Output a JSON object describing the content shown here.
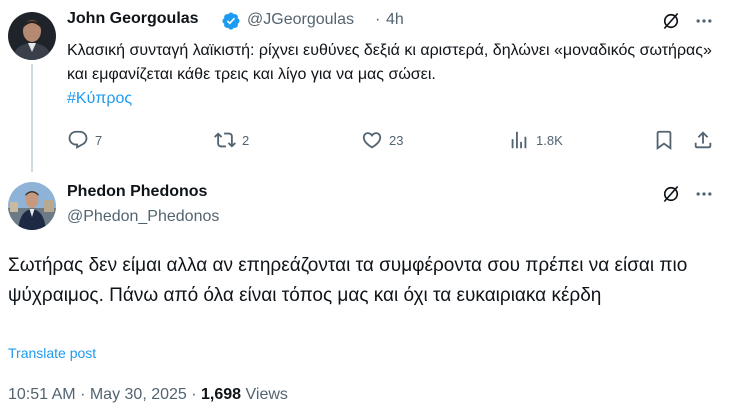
{
  "tweet1": {
    "name": "John Georgoulas",
    "handle": "@JGeorgoulas",
    "sep": "·",
    "time": "4h",
    "text": "Κλασική συνταγή λαϊκιστή: ρίχνει ευθύνες δεξιά κι αριστερά, δηλώνει «μοναδικός σωτήρας» και εμφανίζεται κάθε τρεις και λίγο για να μας σώσει.",
    "hashtag": "#Κύπρος",
    "actions": {
      "replies": "7",
      "reposts": "2",
      "likes": "23",
      "views": "1.8K"
    }
  },
  "tweet2": {
    "name": "Phedon Phedonos",
    "handle": "@Phedon_Phedonos",
    "text": "Σωτήρας δεν είμαι αλλα αν επηρεάζονται τα συμφέροντα σου πρέπει να είσαι πιο ψύχραιμος.  Πάνω από όλα είναι τόπος μας και όχι τα ευκαιριακα κέρδη",
    "translate": "Translate post",
    "time": "10:51 AM",
    "dot1": "·",
    "date": "May 30, 2025",
    "dot2": "·",
    "views_count": "1,698",
    "views_label": "Views"
  },
  "colors": {
    "accent": "#1d9bf0",
    "text": "#0f1419",
    "secondary": "#536471",
    "line": "#cfd9de"
  }
}
